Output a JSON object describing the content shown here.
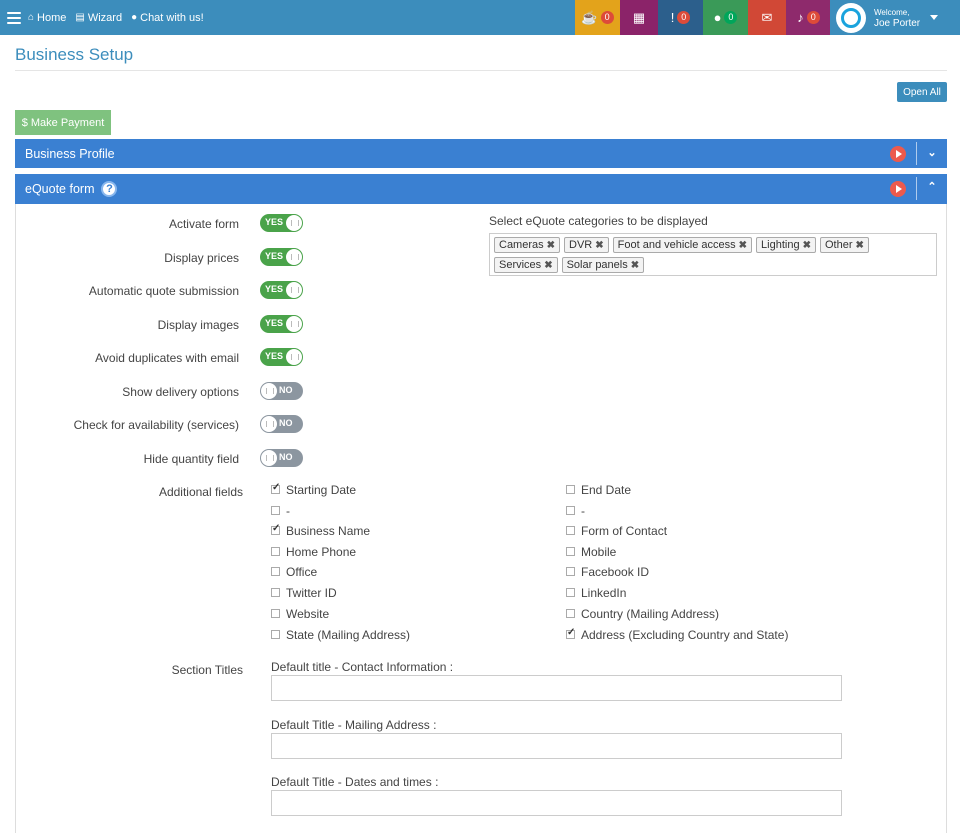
{
  "nav": {
    "links": [
      "Home",
      "Wizard",
      "Chat with us!"
    ],
    "tiles": [
      {
        "icon": "lightbulb-icon",
        "glyph": "☕",
        "count": "0",
        "bg": "#e3a31b",
        "badge": "red"
      },
      {
        "icon": "calendar-icon",
        "glyph": "▦",
        "count": "",
        "bg": "#8b2369",
        "badge": "none"
      },
      {
        "icon": "alert-icon",
        "glyph": "!",
        "count": "0",
        "bg": "#2c5f8c",
        "badge": "red"
      },
      {
        "icon": "comment-icon",
        "glyph": "●",
        "count": "0",
        "bg": "#3a9a58",
        "badge": "green"
      },
      {
        "icon": "envelope-icon",
        "glyph": "✉",
        "count": "",
        "bg": "#d14836",
        "badge": "none"
      },
      {
        "icon": "bell-icon",
        "glyph": "♪",
        "count": "0",
        "bg": "#8e2a6c",
        "badge": "red"
      }
    ],
    "welcome": "Welcome,",
    "user_name": "Joe Porter"
  },
  "page": {
    "title": "Business Setup",
    "open_all": "Open All",
    "make_payment": "$ Make Payment"
  },
  "panels": {
    "business_profile": "Business Profile",
    "equote_form": "eQuote form",
    "help": "?"
  },
  "settings": [
    {
      "label": "Activate form",
      "value": "YES"
    },
    {
      "label": "Display prices",
      "value": "YES"
    },
    {
      "label": "Automatic quote submission",
      "value": "YES"
    },
    {
      "label": "Display images",
      "value": "YES"
    },
    {
      "label": "Avoid duplicates with email",
      "value": "YES"
    },
    {
      "label": "Show delivery options",
      "value": "NO"
    },
    {
      "label": "Check for availability (services)",
      "value": "NO"
    },
    {
      "label": "Hide quantity field",
      "value": "NO"
    }
  ],
  "categories": {
    "label": "Select eQuote categories to be displayed",
    "items": [
      "Cameras",
      "DVR",
      "Foot and vehicle access",
      "Lighting",
      "Other",
      "Services",
      "Solar panels"
    ]
  },
  "additional_fields": {
    "label": "Additional fields",
    "left": [
      {
        "label": "Starting Date",
        "checked": true
      },
      {
        "label": "-",
        "checked": false
      },
      {
        "label": "Business Name",
        "checked": true
      },
      {
        "label": "Home Phone",
        "checked": false
      },
      {
        "label": "Office",
        "checked": false
      },
      {
        "label": "Twitter ID",
        "checked": false
      },
      {
        "label": "Website",
        "checked": false
      },
      {
        "label": "State (Mailing Address)",
        "checked": false
      }
    ],
    "right": [
      {
        "label": "End Date",
        "checked": false
      },
      {
        "label": "-",
        "checked": false
      },
      {
        "label": "Form of Contact",
        "checked": false
      },
      {
        "label": "Mobile",
        "checked": false
      },
      {
        "label": "Facebook ID",
        "checked": false
      },
      {
        "label": "LinkedIn",
        "checked": false
      },
      {
        "label": "Country (Mailing Address)",
        "checked": false
      },
      {
        "label": "Address (Excluding Country and State)",
        "checked": true
      }
    ]
  },
  "section_titles": {
    "label": "Section Titles",
    "fields": [
      {
        "label": "Default title - Contact Information :",
        "value": ""
      },
      {
        "label": "Default Title - Mailing Address :",
        "value": ""
      },
      {
        "label": "Default Title - Dates and times :",
        "value": ""
      }
    ]
  }
}
